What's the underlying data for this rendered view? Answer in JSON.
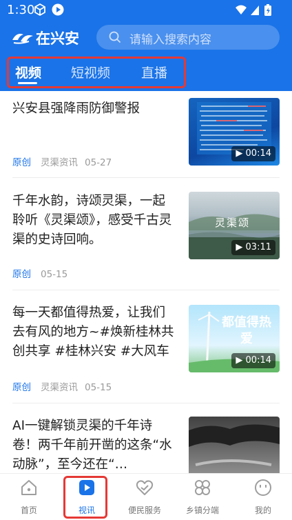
{
  "status_bar": {
    "time": "1:30"
  },
  "header": {
    "app_name": "在兴安",
    "search_placeholder": "请输入搜索内容",
    "tabs": [
      {
        "label": "视频",
        "active": true
      },
      {
        "label": "短视频",
        "active": false
      },
      {
        "label": "直播",
        "active": false
      }
    ]
  },
  "list": [
    {
      "title": "兴安县强降雨防御警报",
      "tag": "原创",
      "source": "灵渠资讯",
      "date": "05-27",
      "duration": "00:14",
      "thumb_text": ""
    },
    {
      "title": "千年水韵，诗颂灵渠，一起聆听《灵渠颂》，感受千古灵渠的史诗回响。",
      "tag": "原创",
      "source": "",
      "date": "05-15",
      "duration": "03:11",
      "thumb_text": "灵渠颂"
    },
    {
      "title": "每一天都值得热爱，让我们去有风的地方~#焕新桂林共创共享 #桂林兴安 #大风车",
      "tag": "原创",
      "source": "灵渠资讯",
      "date": "05-15",
      "duration": "00:14",
      "thumb_text": "都值得热爱"
    },
    {
      "title": "AI一键解锁灵渠的千年诗卷！两千年前开凿的这条“水动脉”，至今还在“…",
      "tag": "",
      "source": "",
      "date": "",
      "duration": "",
      "thumb_text": ""
    }
  ],
  "bottom_nav": [
    {
      "label": "首页",
      "icon": "home-icon",
      "active": false
    },
    {
      "label": "视讯",
      "icon": "play-icon",
      "active": true
    },
    {
      "label": "便民服务",
      "icon": "heart-hands-icon",
      "active": false
    },
    {
      "label": "乡镇分端",
      "icon": "clover-icon",
      "active": false
    },
    {
      "label": "我的",
      "icon": "smile-icon",
      "active": false
    }
  ],
  "colors": {
    "brand": "#1a73e8",
    "highlight": "#e53935"
  }
}
